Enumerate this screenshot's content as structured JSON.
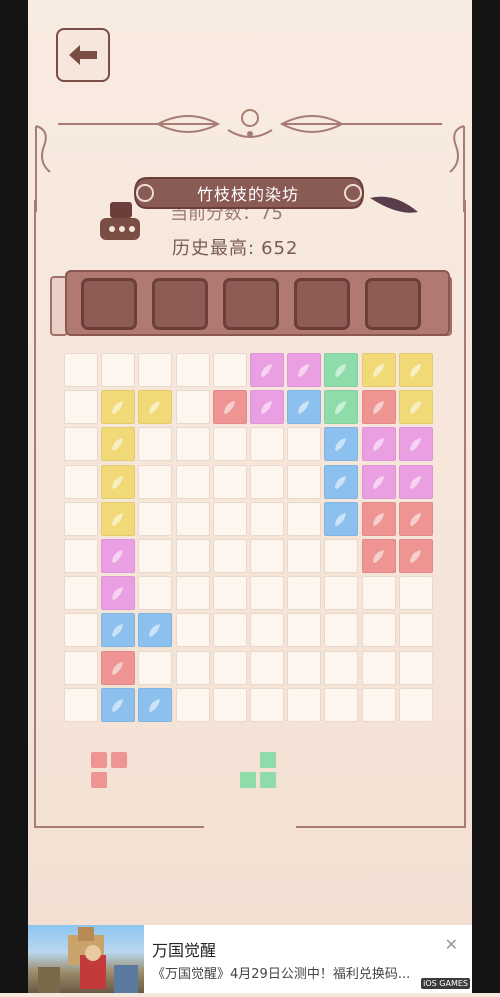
{
  "header": {
    "back_icon": "arrow-left-icon",
    "title": "竹枝枝的染坊",
    "score_label_partial": "当前分数：",
    "score_value_partial": "75",
    "best_label": "历史最高:",
    "best_value": "652"
  },
  "tray": {
    "slots": 5
  },
  "colors": {
    "pink": "#eb9fe3",
    "yellow": "#f2d978",
    "green": "#8fdcab",
    "red": "#ee9492",
    "blue": "#8cc0ee",
    "empty": "#fdf6ef",
    "frame": "#a77d73"
  },
  "board": {
    "rows": [
      [
        "",
        "",
        "",
        "",
        "",
        "pink",
        "pink",
        "green",
        "yellow",
        "yellow"
      ],
      [
        "",
        "yellow",
        "yellow",
        "",
        "red",
        "pink",
        "blue",
        "green",
        "red",
        "yellow"
      ],
      [
        "",
        "yellow",
        "",
        "",
        "",
        "",
        "",
        "blue",
        "pink",
        "pink"
      ],
      [
        "",
        "yellow",
        "",
        "",
        "",
        "",
        "",
        "blue",
        "pink",
        "pink"
      ],
      [
        "",
        "yellow",
        "",
        "",
        "",
        "",
        "",
        "blue",
        "red",
        "red"
      ],
      [
        "",
        "pink",
        "",
        "",
        "",
        "",
        "",
        "",
        "red",
        "red"
      ],
      [
        "",
        "pink",
        "",
        "",
        "",
        "",
        "",
        "",
        "",
        ""
      ],
      [
        "",
        "blue",
        "blue",
        "",
        "",
        "",
        "",
        "",
        "",
        ""
      ],
      [
        "",
        "red",
        "",
        "",
        "",
        "",
        "",
        "",
        "",
        ""
      ],
      [
        "",
        "blue",
        "blue",
        "",
        "",
        "",
        "",
        "",
        "",
        ""
      ]
    ]
  },
  "pieces": [
    {
      "color": "red",
      "cells": [
        [
          0,
          0
        ],
        [
          1,
          0
        ],
        [
          0,
          1
        ]
      ]
    },
    {
      "color": "green",
      "cells": [
        [
          1,
          0
        ],
        [
          0,
          1
        ],
        [
          1,
          1
        ]
      ]
    }
  ],
  "ad": {
    "title": "万国觉醒",
    "description": "《万国觉醒》4月29日公测中！福利兑换码...",
    "close_icon": "close-icon",
    "watermark": "iOS GAMES"
  }
}
